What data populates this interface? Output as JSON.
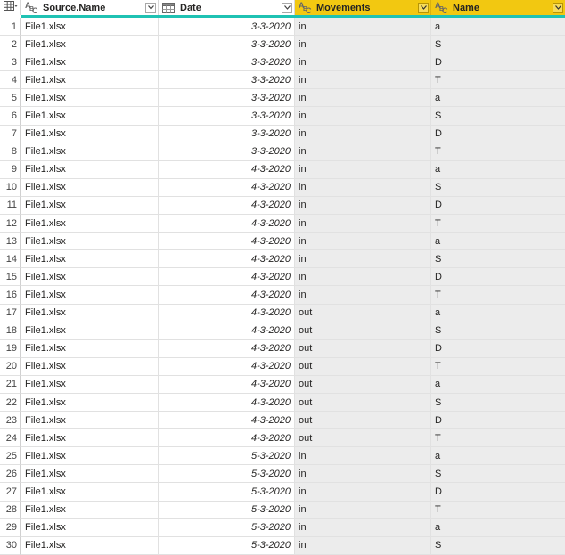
{
  "columns": [
    {
      "name": "Source.Name",
      "type_icon": "abc-text-icon"
    },
    {
      "name": "Date",
      "type_icon": "calendar-table-icon"
    },
    {
      "name": "Movements",
      "type_icon": "abc-text-icon",
      "selected": true
    },
    {
      "name": "Name",
      "type_icon": "abc-text-icon",
      "selected": true
    }
  ],
  "colors": {
    "selected_header": "#f2c811",
    "quality_bar": "#1fc2b3",
    "selected_column_bg": "#ececec"
  },
  "rows": [
    {
      "n": "1",
      "source": "File1.xlsx",
      "date": "3-3-2020",
      "movement": "in",
      "name": "a"
    },
    {
      "n": "2",
      "source": "File1.xlsx",
      "date": "3-3-2020",
      "movement": "in",
      "name": "S"
    },
    {
      "n": "3",
      "source": "File1.xlsx",
      "date": "3-3-2020",
      "movement": "in",
      "name": "D"
    },
    {
      "n": "4",
      "source": "File1.xlsx",
      "date": "3-3-2020",
      "movement": "in",
      "name": "T"
    },
    {
      "n": "5",
      "source": "File1.xlsx",
      "date": "3-3-2020",
      "movement": "in",
      "name": "a"
    },
    {
      "n": "6",
      "source": "File1.xlsx",
      "date": "3-3-2020",
      "movement": "in",
      "name": "S"
    },
    {
      "n": "7",
      "source": "File1.xlsx",
      "date": "3-3-2020",
      "movement": "in",
      "name": "D"
    },
    {
      "n": "8",
      "source": "File1.xlsx",
      "date": "3-3-2020",
      "movement": "in",
      "name": "T"
    },
    {
      "n": "9",
      "source": "File1.xlsx",
      "date": "4-3-2020",
      "movement": "in",
      "name": "a"
    },
    {
      "n": "10",
      "source": "File1.xlsx",
      "date": "4-3-2020",
      "movement": "in",
      "name": "S"
    },
    {
      "n": "11",
      "source": "File1.xlsx",
      "date": "4-3-2020",
      "movement": "in",
      "name": "D"
    },
    {
      "n": "12",
      "source": "File1.xlsx",
      "date": "4-3-2020",
      "movement": "in",
      "name": "T"
    },
    {
      "n": "13",
      "source": "File1.xlsx",
      "date": "4-3-2020",
      "movement": "in",
      "name": "a"
    },
    {
      "n": "14",
      "source": "File1.xlsx",
      "date": "4-3-2020",
      "movement": "in",
      "name": "S"
    },
    {
      "n": "15",
      "source": "File1.xlsx",
      "date": "4-3-2020",
      "movement": "in",
      "name": "D"
    },
    {
      "n": "16",
      "source": "File1.xlsx",
      "date": "4-3-2020",
      "movement": "in",
      "name": "T"
    },
    {
      "n": "17",
      "source": "File1.xlsx",
      "date": "4-3-2020",
      "movement": "out",
      "name": "a"
    },
    {
      "n": "18",
      "source": "File1.xlsx",
      "date": "4-3-2020",
      "movement": "out",
      "name": "S"
    },
    {
      "n": "19",
      "source": "File1.xlsx",
      "date": "4-3-2020",
      "movement": "out",
      "name": "D"
    },
    {
      "n": "20",
      "source": "File1.xlsx",
      "date": "4-3-2020",
      "movement": "out",
      "name": "T"
    },
    {
      "n": "21",
      "source": "File1.xlsx",
      "date": "4-3-2020",
      "movement": "out",
      "name": "a"
    },
    {
      "n": "22",
      "source": "File1.xlsx",
      "date": "4-3-2020",
      "movement": "out",
      "name": "S"
    },
    {
      "n": "23",
      "source": "File1.xlsx",
      "date": "4-3-2020",
      "movement": "out",
      "name": "D"
    },
    {
      "n": "24",
      "source": "File1.xlsx",
      "date": "4-3-2020",
      "movement": "out",
      "name": "T"
    },
    {
      "n": "25",
      "source": "File1.xlsx",
      "date": "5-3-2020",
      "movement": "in",
      "name": "a"
    },
    {
      "n": "26",
      "source": "File1.xlsx",
      "date": "5-3-2020",
      "movement": "in",
      "name": "S"
    },
    {
      "n": "27",
      "source": "File1.xlsx",
      "date": "5-3-2020",
      "movement": "in",
      "name": "D"
    },
    {
      "n": "28",
      "source": "File1.xlsx",
      "date": "5-3-2020",
      "movement": "in",
      "name": "T"
    },
    {
      "n": "29",
      "source": "File1.xlsx",
      "date": "5-3-2020",
      "movement": "in",
      "name": "a"
    },
    {
      "n": "30",
      "source": "File1.xlsx",
      "date": "5-3-2020",
      "movement": "in",
      "name": "S"
    }
  ]
}
